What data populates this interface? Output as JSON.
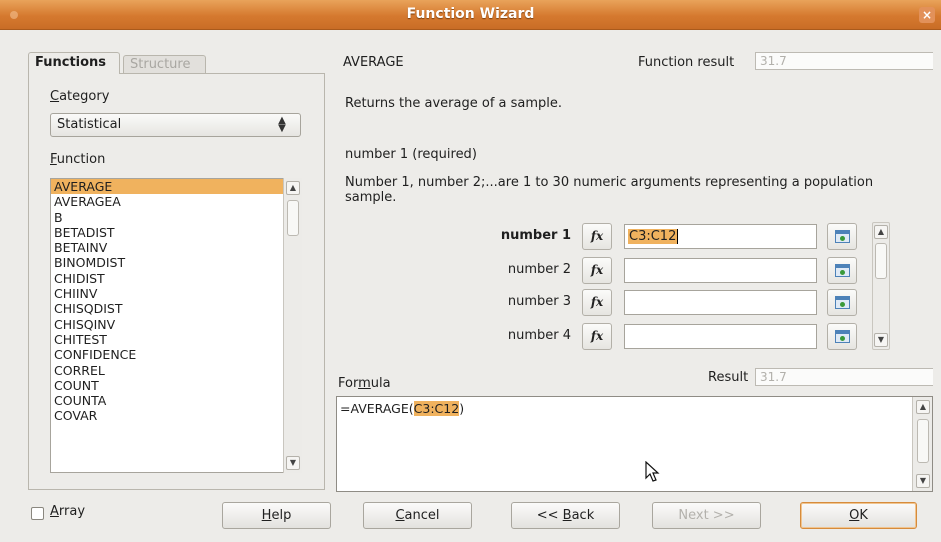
{
  "window": {
    "title": "Function Wizard",
    "close_glyph": "×",
    "accent": "#d5792f"
  },
  "tabs": [
    {
      "label": "Functions",
      "active": true
    },
    {
      "label": "Structure",
      "active": false
    }
  ],
  "category": {
    "label": "Category",
    "value": "Statistical"
  },
  "function_list": {
    "label": "Function",
    "items": [
      "AVERAGE",
      "AVERAGEA",
      "B",
      "BETADIST",
      "BETAINV",
      "BINOMDIST",
      "CHIDIST",
      "CHIINV",
      "CHISQDIST",
      "CHISQINV",
      "CHITEST",
      "CONFIDENCE",
      "CORREL",
      "COUNT",
      "COUNTA",
      "COVAR"
    ],
    "selected": "AVERAGE"
  },
  "details": {
    "function_name": "AVERAGE",
    "function_result_label": "Function result",
    "function_result_value": "31.7",
    "description": "Returns the average of a sample.",
    "arg_title": "number 1 (required)",
    "arg_description": "Number 1, number 2;...are 1 to 30 numeric arguments representing a population sample."
  },
  "arguments": [
    {
      "label": "number 1",
      "value": "C3:C12",
      "bold": true
    },
    {
      "label": "number 2",
      "value": ""
    },
    {
      "label": "number 3",
      "value": ""
    },
    {
      "label": "number 4",
      "value": ""
    }
  ],
  "fx_glyph": "fx",
  "formula": {
    "label": "Formula",
    "prefix": "=AVERAGE(",
    "reference": "C3:C12",
    "suffix": ")",
    "result_label": "Result",
    "result_value": "31.7"
  },
  "bottom": {
    "array_label": "Array",
    "help": "Help",
    "cancel": "Cancel",
    "back": "<< Back",
    "next": "Next >>",
    "ok": "OK"
  }
}
